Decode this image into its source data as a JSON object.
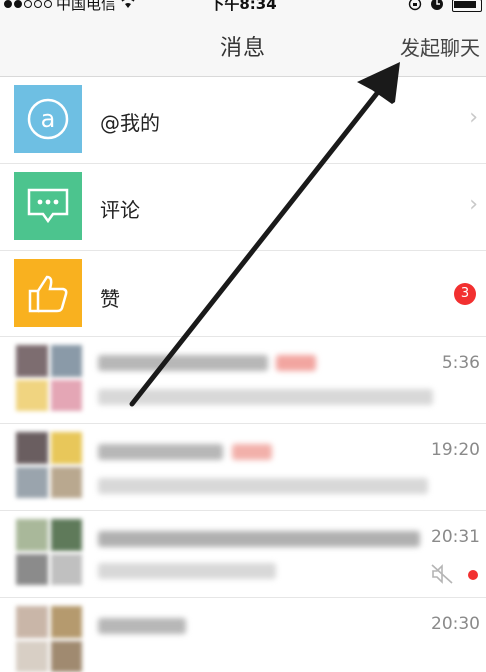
{
  "status_bar": {
    "carrier": "中国电信",
    "time": "下午8:34"
  },
  "nav": {
    "title": "消息",
    "action": "发起聊天"
  },
  "entries": [
    {
      "label": "@我的",
      "icon": "at-icon",
      "color": "#6ebfe3"
    },
    {
      "label": "评论",
      "icon": "comment-icon",
      "color": "#4cc48e"
    },
    {
      "label": "赞",
      "icon": "thumbs-up-icon",
      "color": "#f9b11f",
      "badge": "3"
    }
  ],
  "conversations": [
    {
      "time": "5:36",
      "muted": false,
      "unread": false
    },
    {
      "time": "19:20",
      "muted": false,
      "unread": false
    },
    {
      "time": "20:31",
      "muted": true,
      "unread": true
    },
    {
      "time": "20:30",
      "muted": false,
      "unread": false
    }
  ],
  "annotation": {
    "type": "arrow",
    "color": "#1a1a1a"
  }
}
